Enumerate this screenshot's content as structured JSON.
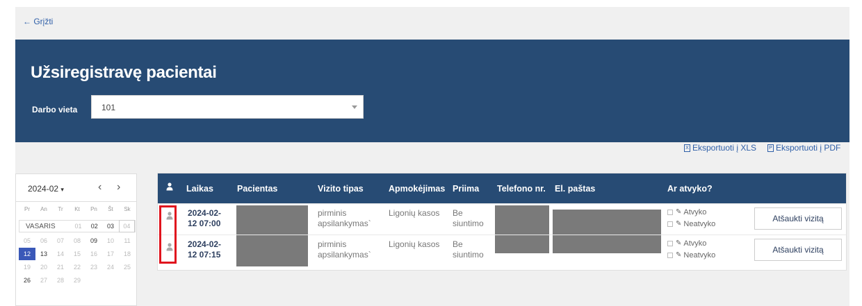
{
  "back_link": "← Grįžti",
  "header": {
    "title": "Užsiregistravę pacientai",
    "workplace_label": "Darbo vieta",
    "workplace_value": "101"
  },
  "exports": {
    "xls": "Eksportuoti į XLS",
    "pdf": "Eksportuoti į PDF"
  },
  "calendar": {
    "month_label": "2024-02",
    "weekdays": [
      "Pr",
      "An",
      "Tr",
      "Kt",
      "Pn",
      "Št",
      "Sk"
    ],
    "month_name": "VASARIS",
    "first_row": [
      "01",
      "02",
      "03",
      "04"
    ],
    "rows": [
      [
        "05",
        "06",
        "07",
        "08",
        "09",
        "10",
        "11"
      ],
      [
        "12",
        "13",
        "14",
        "15",
        "16",
        "17",
        "18"
      ],
      [
        "19",
        "20",
        "21",
        "22",
        "23",
        "24",
        "25"
      ],
      [
        "26",
        "27",
        "28",
        "29"
      ]
    ],
    "selected_day": "12"
  },
  "table": {
    "columns": [
      "Laikas",
      "Pacientas",
      "Vizito tipas",
      "Apmokėjimas",
      "Priima",
      "Telefono nr.",
      "El. paštas",
      "Ar atvyko?"
    ],
    "rows": [
      {
        "time": "2024-02-12 07:00",
        "visit_type": "pirminis apsilankymas`",
        "payment": "Ligonių kasos",
        "accepts": "Be siuntimo",
        "arrived": "Atvyko",
        "not_arrived": "Neatvyko",
        "cancel": "Atšaukti vizitą"
      },
      {
        "time": "2024-02-12 07:15",
        "visit_type": "pirminis apsilankymas`",
        "payment": "Ligonių kasos",
        "accepts": "Be siuntimo",
        "arrived": "Atvyko",
        "not_arrived": "Neatvyko",
        "cancel": "Atšaukti vizitą"
      }
    ]
  },
  "colors": {
    "header_bg": "#274b74",
    "link": "#2f5fa8",
    "selected_day": "#3a58b8",
    "highlight": "#e0141e"
  }
}
